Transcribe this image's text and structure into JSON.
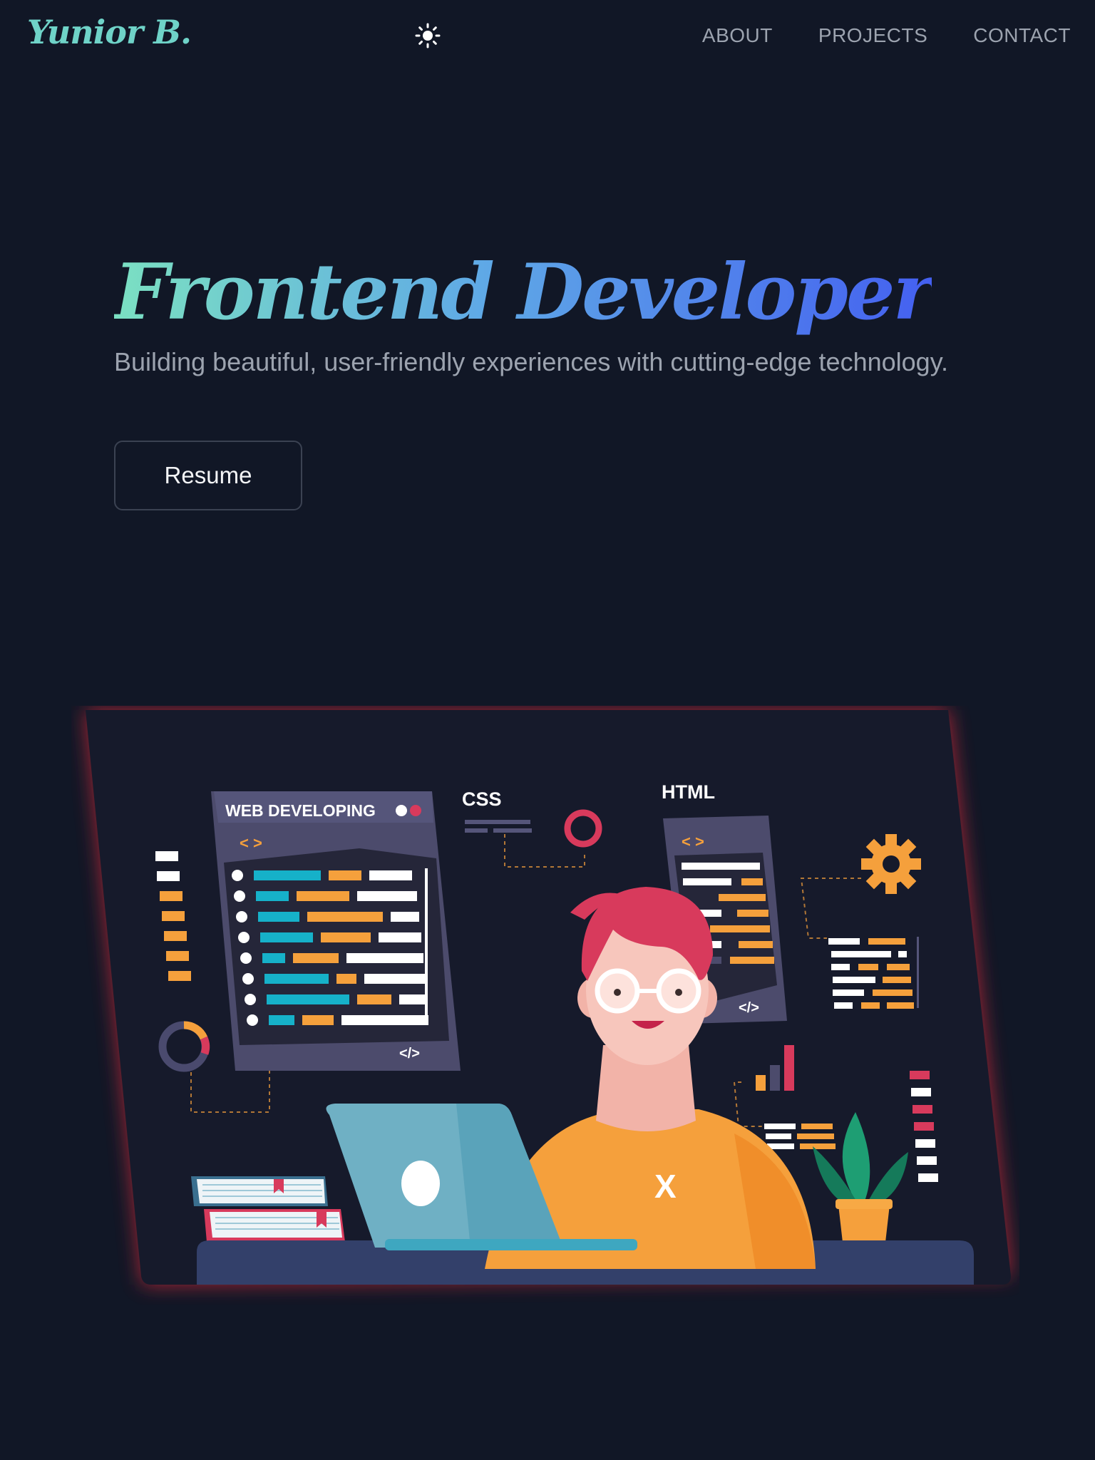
{
  "brand": {
    "name": "Yunior B."
  },
  "nav": {
    "theme_toggle_icon": "sun-icon",
    "links": [
      {
        "label": "ABOUT"
      },
      {
        "label": "PROJECTS"
      },
      {
        "label": "CONTACT"
      }
    ]
  },
  "hero": {
    "title": "Frontend Developer",
    "subtitle": "Building beautiful, user-friendly experiences with cutting-edge technology.",
    "resume_label": "Resume"
  },
  "illustration": {
    "panel_title": "WEB DEVELOPING",
    "css_label": "CSS",
    "html_label": "HTML",
    "code_tag_open": "< >",
    "code_tag_close": "</>",
    "shirt_letter": "X"
  },
  "colors": {
    "background": "#111726",
    "logo": "#6fd3c8",
    "title_gradient_start": "#7be0c2",
    "title_gradient_end": "#4460f0",
    "illustration_glow": "#e02a3a",
    "teal": "#16b1c9",
    "orange": "#f5a03c",
    "crimson": "#d83a5c"
  }
}
